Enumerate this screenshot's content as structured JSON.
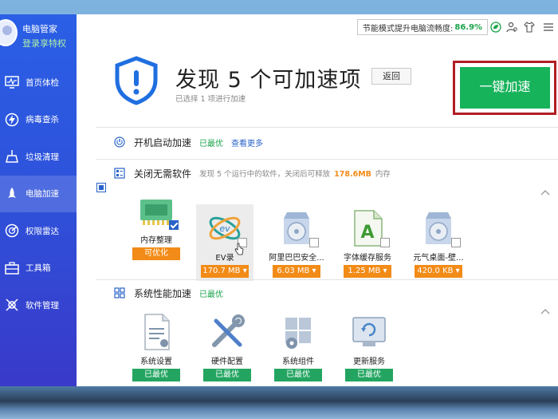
{
  "app": {
    "profile_name": "电脑管家",
    "profile_sub": "登录享特权",
    "energy_label": "节能模式提升电脑流畅度:",
    "energy_value": "86.9%"
  },
  "sidebar": {
    "items": [
      {
        "label": "首页体检",
        "icon": "monitor-icon"
      },
      {
        "label": "病毒查杀",
        "icon": "lightning-icon"
      },
      {
        "label": "垃圾清理",
        "icon": "broom-icon"
      },
      {
        "label": "电脑加速",
        "icon": "rocket-icon"
      },
      {
        "label": "权限雷达",
        "icon": "radar-icon"
      },
      {
        "label": "工具箱",
        "icon": "toolbox-icon"
      },
      {
        "label": "软件管理",
        "icon": "gear-cross-icon"
      }
    ]
  },
  "header": {
    "title": "发现 5 个可加速项",
    "back_label": "返回",
    "selected_note": "已选择 1 项进行加速",
    "speedup_label": "一键加速"
  },
  "sections": {
    "startup": {
      "title": "开机启动加速",
      "status": "已最优",
      "link": "查看更多"
    },
    "close_software": {
      "title": "关闭无需软件",
      "desc_prefix": "发现 5 个运行中的软件，关闭后可释放",
      "desc_size": "178.6MB",
      "desc_suffix": "内存",
      "tiles": [
        {
          "label": "内存整理",
          "badge": "可优化",
          "checked": true,
          "icon": "memory-chip-icon"
        },
        {
          "label": "EV录",
          "badge": "170.7 MB ▾",
          "checked": false,
          "icon": "ev-recorder-icon"
        },
        {
          "label": "阿里巴巴安全...",
          "badge": "6.03 MB ▾",
          "checked": false,
          "icon": "disc-box-icon"
        },
        {
          "label": "字体缓存服务",
          "badge": "1.25 MB ▾",
          "checked": false,
          "icon": "font-cache-icon"
        },
        {
          "label": "元气桌面-壁...",
          "badge": "420.0 KB ▾",
          "checked": false,
          "icon": "disc-box-icon"
        }
      ]
    },
    "system": {
      "title": "系统性能加速",
      "status": "已最优",
      "tiles": [
        {
          "label": "系统设置",
          "badge": "已最优",
          "icon": "document-icon"
        },
        {
          "label": "硬件配置",
          "badge": "已最优",
          "icon": "tools-icon"
        },
        {
          "label": "系统组件",
          "badge": "已最优",
          "icon": "windows-gear-icon"
        },
        {
          "label": "更新服务",
          "badge": "已最优",
          "icon": "update-icon"
        }
      ]
    }
  },
  "colors": {
    "accent_green": "#17b35b",
    "highlight_red": "#b01e24",
    "badge_orange": "#f28b17",
    "badge_green": "#23a561",
    "sidebar_blue": "#2a5fe6"
  }
}
